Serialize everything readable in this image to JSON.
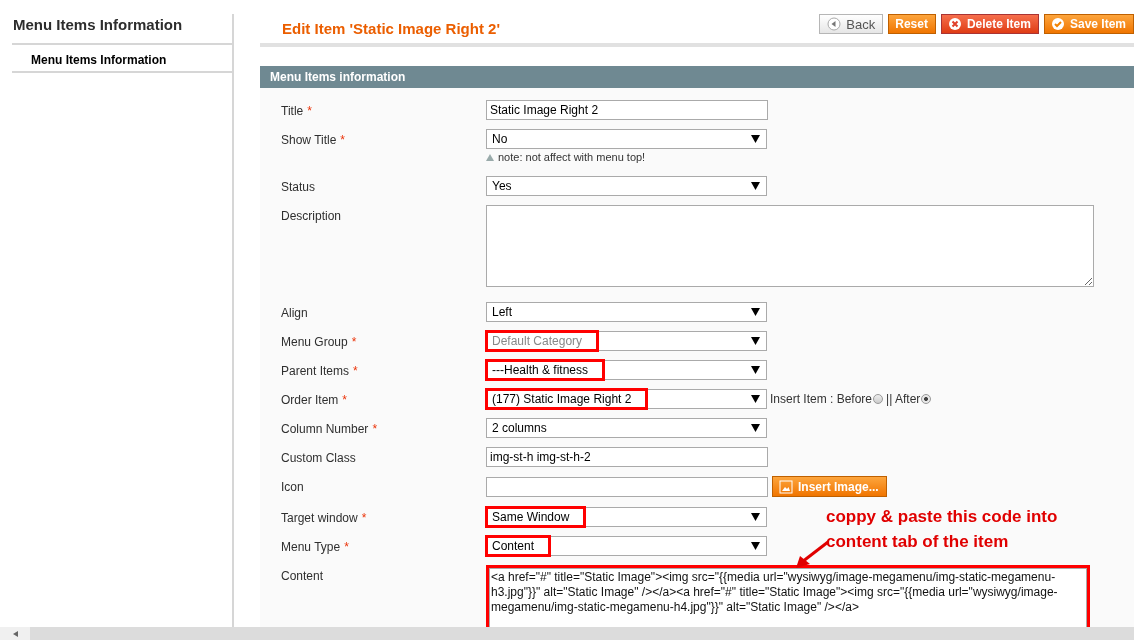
{
  "sidebar": {
    "title": "Menu Items Information",
    "items": [
      {
        "label": "Menu Items Information",
        "selected": true
      }
    ]
  },
  "page_title": "Edit Item 'Static Image Right 2'",
  "buttons": [
    {
      "label": "Back",
      "kind": "back"
    },
    {
      "label": "Reset",
      "kind": "reset"
    },
    {
      "label": "Delete Item",
      "kind": "delete"
    },
    {
      "label": "Save Item",
      "kind": "save"
    }
  ],
  "section": {
    "title": "Menu Items information"
  },
  "fields": [
    {
      "label": "Title",
      "marker": "*",
      "kind": "text",
      "value": "Static Image Right 2",
      "highlighted": false
    },
    {
      "label": "Show Title",
      "marker": "*",
      "kind": "select",
      "value": "No",
      "note": "note: not affect with menu top!",
      "highlighted": false
    },
    {
      "label": "Status",
      "kind": "select",
      "value": "Yes",
      "highlighted": false
    },
    {
      "label": "Description",
      "kind": "textarea",
      "highlighted": false
    },
    {
      "label": "Align",
      "kind": "select",
      "value": "Left",
      "highlighted": false
    },
    {
      "label": "Menu Group",
      "marker": "*",
      "kind": "select",
      "value": "Default Category",
      "disabled": true,
      "highlighted": true
    },
    {
      "label": "Parent Items",
      "marker": "*",
      "kind": "select",
      "value": "---Health & fitness",
      "highlighted": true
    },
    {
      "label": "Order Item",
      "marker": "*",
      "kind": "select",
      "value": "(177) Static Image Right 2",
      "highlighted": true,
      "insert": {
        "label": "Insert Item : Before",
        "separator": "|| After",
        "options": [
          {
            "selected": false
          },
          {
            "selected": true
          }
        ]
      }
    },
    {
      "label": "Column Number",
      "marker": "*",
      "kind": "select",
      "value": "2 columns",
      "highlighted": false
    },
    {
      "label": "Custom Class",
      "kind": "text",
      "value": "img-st-h img-st-h-2",
      "highlighted": false
    },
    {
      "label": "Icon",
      "kind": "image",
      "button": "Insert Image...",
      "highlighted": false
    },
    {
      "label": "Target window",
      "marker": "*",
      "kind": "select",
      "value": "Same Window",
      "highlighted": true
    },
    {
      "label": "Menu Type",
      "marker": "*",
      "kind": "select",
      "value": "Content",
      "highlighted": true
    },
    {
      "label": "Content",
      "kind": "code",
      "value": "<a href=\"#\" title=\"Static Image\"><img src=\"{{media url=\"wysiwyg/image-megamenu/img-static-megamenu-h3.jpg\"}}\" alt=\"Static Image\" /></a><a href=\"#\" title=\"Static Image\"><img src=\"{{media url=\"wysiwyg/image-megamenu/img-static-megamenu-h4.jpg\"}}\" alt=\"Static Image\" /></a>",
      "highlighted": true
    }
  ],
  "annotation": "coppy & paste this code into content tab of the item"
}
